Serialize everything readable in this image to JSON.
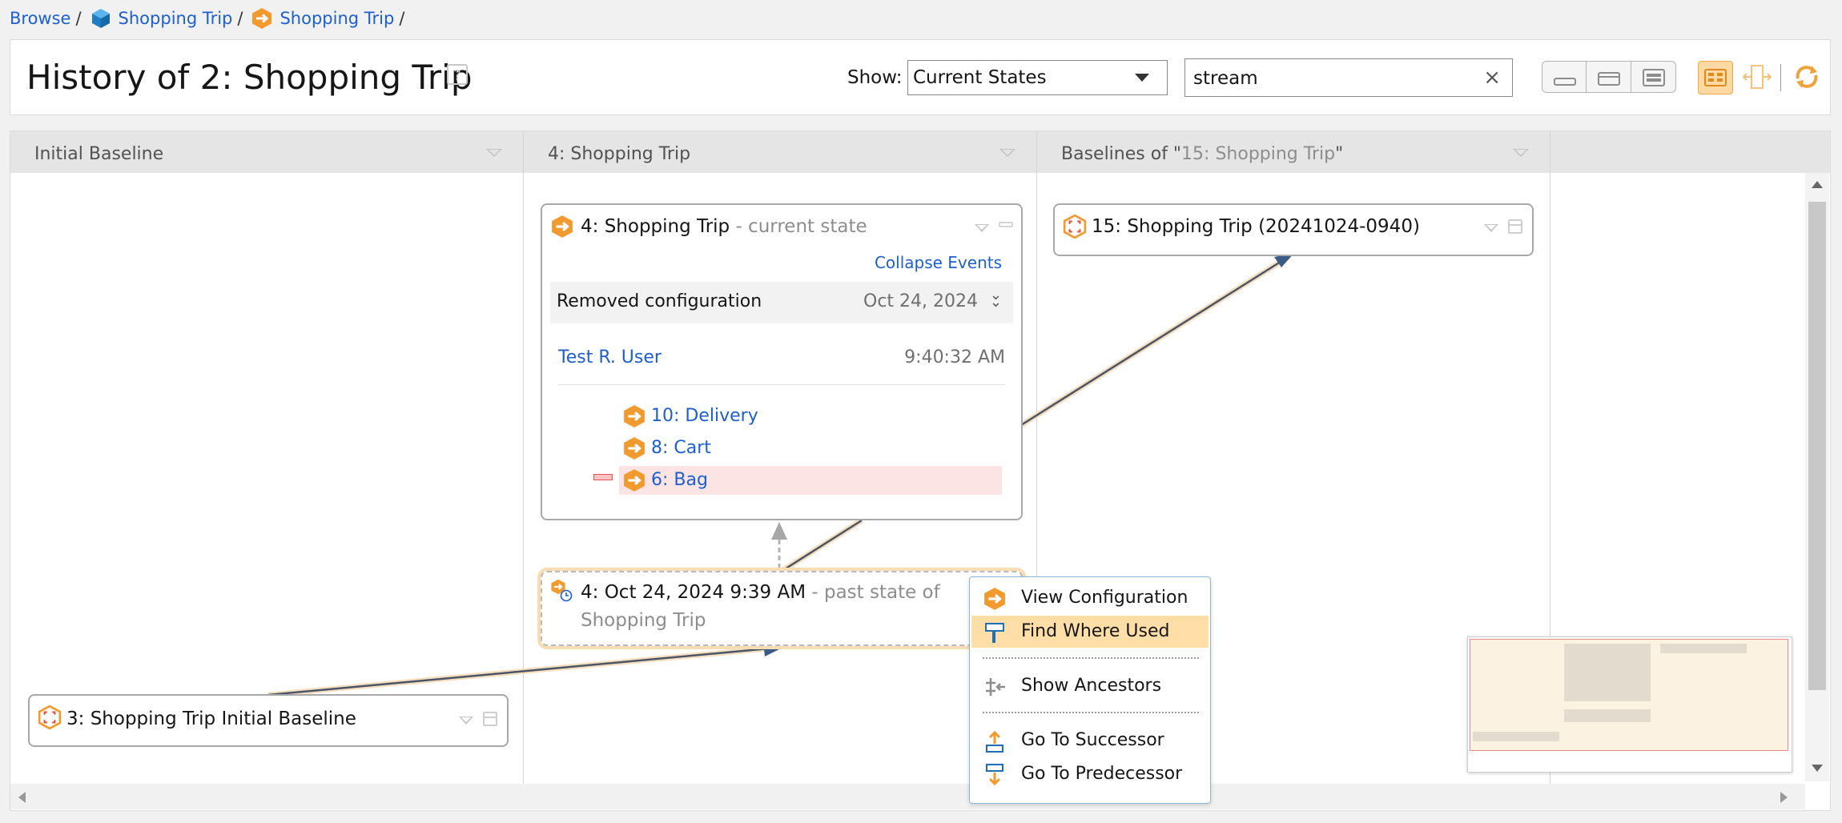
{
  "breadcrumb": {
    "browse": "Browse",
    "items": [
      "Shopping Trip",
      "Shopping Trip"
    ],
    "separator": "/"
  },
  "header": {
    "title": "History of 2: Shopping Trip",
    "help_icon": "?",
    "show_label": "Show:",
    "show_value": "Current States",
    "search_value": "stream",
    "clear_icon": "×"
  },
  "columns": [
    {
      "label": "Initial Baseline"
    },
    {
      "label": "4: Shopping Trip"
    },
    {
      "label_prefix": "Baselines of \"",
      "label_link": "15: Shopping Trip",
      "label_suffix": "\""
    }
  ],
  "current_state_card": {
    "title": "4: Shopping Trip",
    "subtitle": " - current state",
    "collapse_label": "Collapse Events",
    "event": {
      "label": "Removed configuration",
      "date": "Oct 24, 2024"
    },
    "user": "Test R. User",
    "time": "9:40:32 AM",
    "children": [
      {
        "label": "10: Delivery",
        "removed": false
      },
      {
        "label": "8: Cart",
        "removed": false
      },
      {
        "label": "6: Bag",
        "removed": true
      }
    ]
  },
  "past_state_card": {
    "title": "4: Oct 24, 2024 9:39 AM",
    "subtitle": " - past state of Shopping Trip"
  },
  "initial_baseline_card": {
    "title": "3: Shopping Trip Initial Baseline"
  },
  "baseline_card": {
    "title": "15: Shopping Trip (20241024-0940)"
  },
  "context_menu": {
    "items": [
      {
        "label": "View Configuration",
        "icon": "configuration-icon"
      },
      {
        "label": "Find Where Used",
        "icon": "signpost-icon",
        "highlighted": true
      },
      {
        "label": "Show Ancestors",
        "icon": "ancestors-icon"
      },
      {
        "label": "Go To Successor",
        "icon": "arrow-up-icon"
      },
      {
        "label": "Go To Predecessor",
        "icon": "arrow-down-icon"
      }
    ]
  },
  "colors": {
    "link": "#1d5fd1",
    "accent_orange": "#f29a2e",
    "highlight": "#ffdea8",
    "removed_bg": "#fde4e4",
    "stream_blue": "#1f8ad6"
  }
}
